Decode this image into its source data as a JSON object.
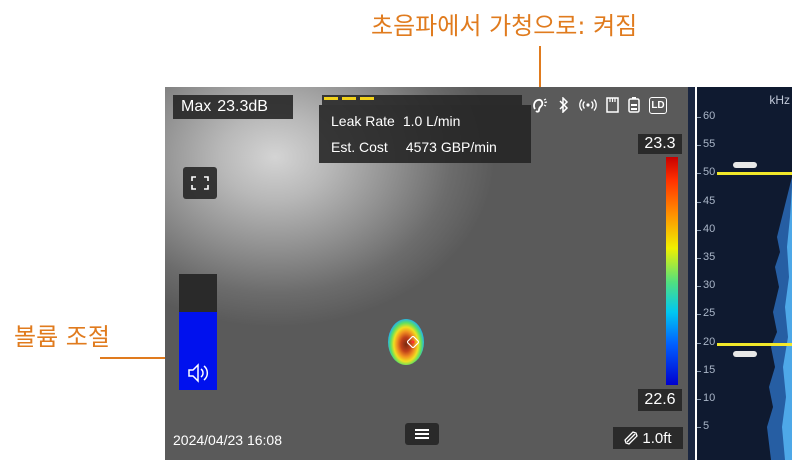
{
  "annotations": {
    "top_label": "초음파에서 가청으로: 켜짐",
    "left_label": "볼륨 조절"
  },
  "camera": {
    "max_label": "Max",
    "max_value": "23.3dB",
    "leak": {
      "rate_label": "Leak Rate",
      "rate_value": "1.0 L/min",
      "cost_label": "Est. Cost",
      "cost_value": "4573 GBP/min"
    },
    "status_icons": [
      "hearing-icon",
      "bluetooth-icon",
      "wireless-icon",
      "sd-card-icon",
      "battery-icon",
      "ld-icon"
    ],
    "ld_badge": "LD",
    "scale_max": "23.3",
    "scale_min": "22.6",
    "timestamp": "2024/04/23 16:08",
    "distance": "1.0ft",
    "volume_level": 0.67
  },
  "spectrum": {
    "unit": "kHz",
    "ticks": [
      "60",
      "55",
      "50",
      "45",
      "40",
      "35",
      "30",
      "25",
      "20",
      "15",
      "10",
      "5"
    ],
    "upper_limit_khz": 51,
    "lower_limit_khz": 19
  },
  "colors": {
    "annotation": "#e07b1e",
    "volume_fill": "#0011ee",
    "limit_line": "#f2e82a"
  }
}
